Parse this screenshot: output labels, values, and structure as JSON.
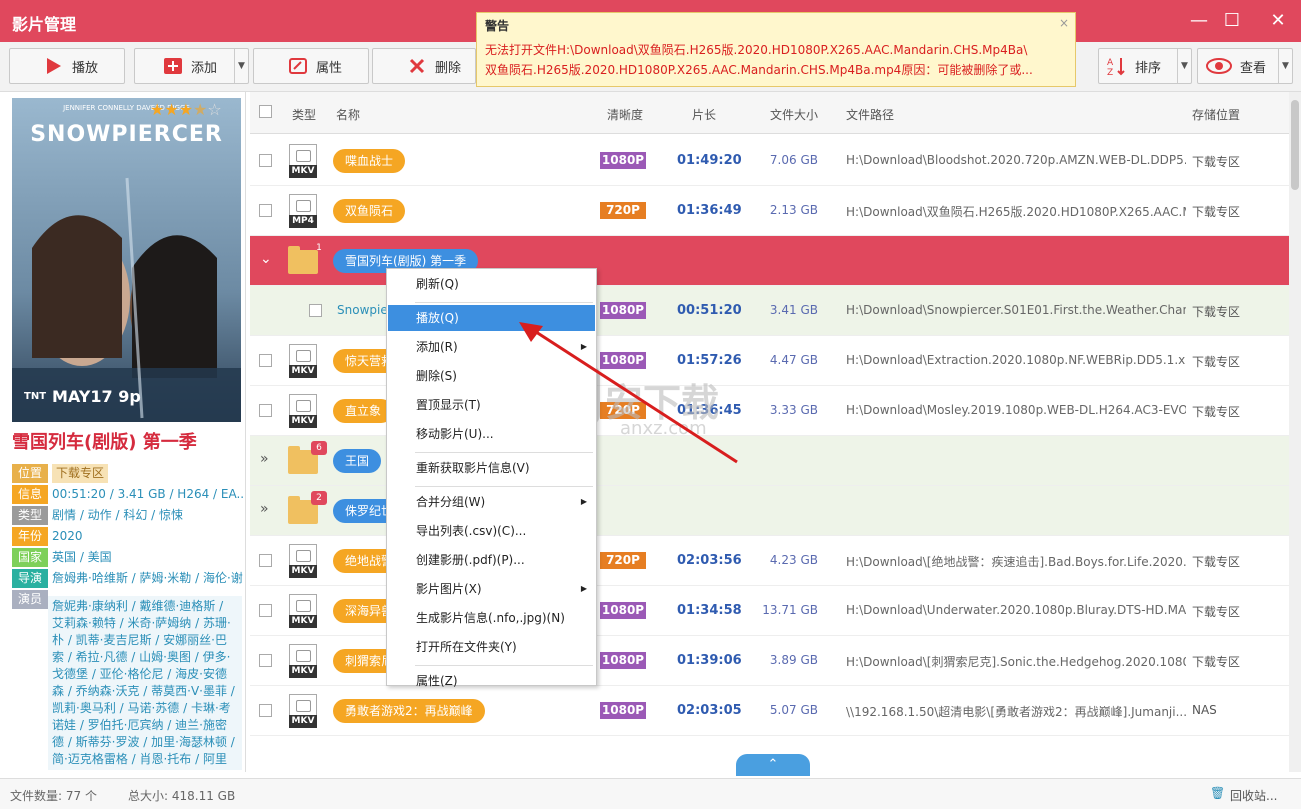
{
  "app_title": "影片管理",
  "window_controls": {
    "min": "—",
    "max": "☐",
    "close": "✕"
  },
  "toolbar": {
    "play": "播放",
    "add": "添加",
    "props": "属性",
    "delete": "删除",
    "sort": "排序",
    "view": "查看"
  },
  "warning": {
    "title": "警告",
    "line1": "无法打开文件H:\\Download\\双鱼陨石.H265版.2020.HD1080P.X265.AAC.Mandarin.CHS.Mp4Ba\\",
    "line2": "双鱼陨石.H265版.2020.HD1080P.X265.AAC.Mandarin.CHS.Mp4Ba.mp4原因：可能被删除了或...",
    "close": "×"
  },
  "detail": {
    "poster_title": "SNOWPIERCER",
    "poster_cast": "JENNIFER CONNELLY   DAVEED DIGGS",
    "poster_date": "MAY17 9p",
    "poster_network": "TNT",
    "rating_stars": 3.5,
    "title": "雪国列车(剧版) 第一季",
    "info": [
      {
        "k": "位置",
        "v": "下载专区",
        "color": "#e8b04a"
      },
      {
        "k": "信息",
        "v": "00:51:20 / 3.41 GB / H264 / EA...",
        "color": "#f5a623"
      },
      {
        "k": "类型",
        "v": "剧情 / 动作 / 科幻 / 惊悚",
        "color": "#9b9b9b"
      },
      {
        "k": "年份",
        "v": "2020",
        "color": "#f5a623"
      },
      {
        "k": "国家",
        "v": "英国 / 美国",
        "color": "#7ed05a"
      },
      {
        "k": "导演",
        "v": "詹姆弗·哈维斯 / 萨姆·米勒 / 海伦·谢",
        "color": "#2ab0a0"
      },
      {
        "k": "演员",
        "v": "",
        "color": "#aab0c0"
      }
    ],
    "cast": "詹妮弗·康纳利 / 戴维德·迪格斯 / 艾莉森·赖特 / 米奇·萨姆纳 / 苏珊·朴 / 凯蒂·麦吉尼斯 / 安娜丽丝·巴索 / 希拉·凡德 / 山姆·奥图 / 伊多·戈德堡 / 亚伦·格伦尼 / 海皮·安德森 / 乔纳森·沃克 / 蒂莫西·V·墨菲 / 凯莉·奥马利 / 马诺·苏德 / 卡琳·考诺娃 / 罗伯托·厄宾纳 / 迪兰·施密德 / 斯蒂芬·罗波 / 加里·海瑟林顿 / 简·迈克格雷格 / 肖恩·托布 / 阿里"
  },
  "table": {
    "headers": {
      "type": "类型",
      "name": "名称",
      "res": "清晰度",
      "dur": "片长",
      "size": "文件大小",
      "path": "文件路径",
      "loc": "存储位置"
    },
    "rows": [
      {
        "kind": "file",
        "ext": "MKV",
        "name": "喋血战士",
        "res": "1080P",
        "dur": "01:49:20",
        "size": "7.06 GB",
        "path": "H:\\Download\\Bloodshot.2020.720p.AMZN.WEB-DL.DDP5.1....",
        "loc": "下载专区"
      },
      {
        "kind": "file",
        "ext": "MP4",
        "name": "双鱼陨石",
        "res": "720P",
        "dur": "01:36:49",
        "size": "2.13 GB",
        "path": "H:\\Download\\双鱼陨石.H265版.2020.HD1080P.X265.AAC.M...",
        "loc": "下载专区"
      },
      {
        "kind": "group-selected",
        "count": "1",
        "name": "雪国列车(剧版) 第一季"
      },
      {
        "kind": "child",
        "name": "Snowpie",
        "res": "1080P",
        "dur": "00:51:20",
        "size": "3.41 GB",
        "path": "H:\\Download\\Snowpiercer.S01E01.First.the.Weather.Chang...",
        "loc": "下载专区"
      },
      {
        "kind": "file",
        "ext": "MKV",
        "name": "惊天营救",
        "res": "1080P",
        "dur": "01:57:26",
        "size": "4.47 GB",
        "path": "H:\\Download\\Extraction.2020.1080p.NF.WEBRip.DD5.1.x26...",
        "loc": "下载专区"
      },
      {
        "kind": "file",
        "ext": "MKV",
        "name": "直立象",
        "res": "720P",
        "dur": "01:36:45",
        "size": "3.33 GB",
        "path": "H:\\Download\\Mosley.2019.1080p.WEB-DL.H264.AC3-EVO[E...",
        "loc": "下载专区"
      },
      {
        "kind": "group",
        "count": "6",
        "name": "王国"
      },
      {
        "kind": "group",
        "count": "2",
        "name": "侏罗纪世"
      },
      {
        "kind": "file",
        "ext": "MKV",
        "name": "绝地战警",
        "res": "720P",
        "dur": "02:03:56",
        "size": "4.23 GB",
        "path": "H:\\Download\\[绝地战警：疾速追击].Bad.Boys.for.Life.2020....",
        "loc": "下载专区"
      },
      {
        "kind": "file",
        "ext": "MKV",
        "name": "深海异兽",
        "res": "1080P",
        "dur": "01:34:58",
        "size": "13.71 GB",
        "path": "H:\\Download\\Underwater.2020.1080p.Bluray.DTS-HD.MA.7....",
        "loc": "下载专区"
      },
      {
        "kind": "file",
        "ext": "MKV",
        "name": "刺猬索尼克",
        "res": "1080P",
        "dur": "01:39:06",
        "size": "3.89 GB",
        "path": "H:\\Download\\[刺猬索尼克].Sonic.the.Hedgehog.2020.1080...",
        "loc": "下载专区"
      },
      {
        "kind": "file",
        "ext": "MKV",
        "name": "勇敢者游戏2：再战巅峰",
        "res": "1080P",
        "dur": "02:03:05",
        "size": "5.07 GB",
        "path": "\\\\192.168.1.50\\超清电影\\[勇敢者游戏2：再战巅峰].Jumanji....",
        "loc": "NAS"
      }
    ]
  },
  "res_colors": {
    "1080P": "#9b59b6",
    "720P": "#e67e22"
  },
  "context_menu": [
    {
      "label": "刷新(Q)",
      "sub": false
    },
    {
      "sep": true
    },
    {
      "label": "播放(Q)",
      "sub": false,
      "hl": true
    },
    {
      "label": "添加(R)",
      "sub": true
    },
    {
      "label": "删除(S)",
      "sub": false
    },
    {
      "label": "置顶显示(T)",
      "sub": false
    },
    {
      "label": "移动影片(U)...",
      "sub": false
    },
    {
      "sep": true
    },
    {
      "label": "重新获取影片信息(V)",
      "sub": false
    },
    {
      "sep": true
    },
    {
      "label": "合并分组(W)",
      "sub": true
    },
    {
      "label": "导出列表(.csv)(C)...",
      "sub": false
    },
    {
      "label": "创建影册(.pdf)(P)...",
      "sub": false
    },
    {
      "label": "影片图片(X)",
      "sub": true
    },
    {
      "label": "生成影片信息(.nfo,.jpg)(N)",
      "sub": false
    },
    {
      "label": "打开所在文件夹(Y)",
      "sub": false
    },
    {
      "sep": true
    },
    {
      "label": "属性(Z)",
      "sub": false
    }
  ],
  "statusbar": {
    "count": "文件数量: 77 个",
    "total": "总大小: 418.11 GB",
    "recycle": "回收站..."
  },
  "watermark": {
    "main": "安下载",
    "sub": "anxz.com"
  }
}
